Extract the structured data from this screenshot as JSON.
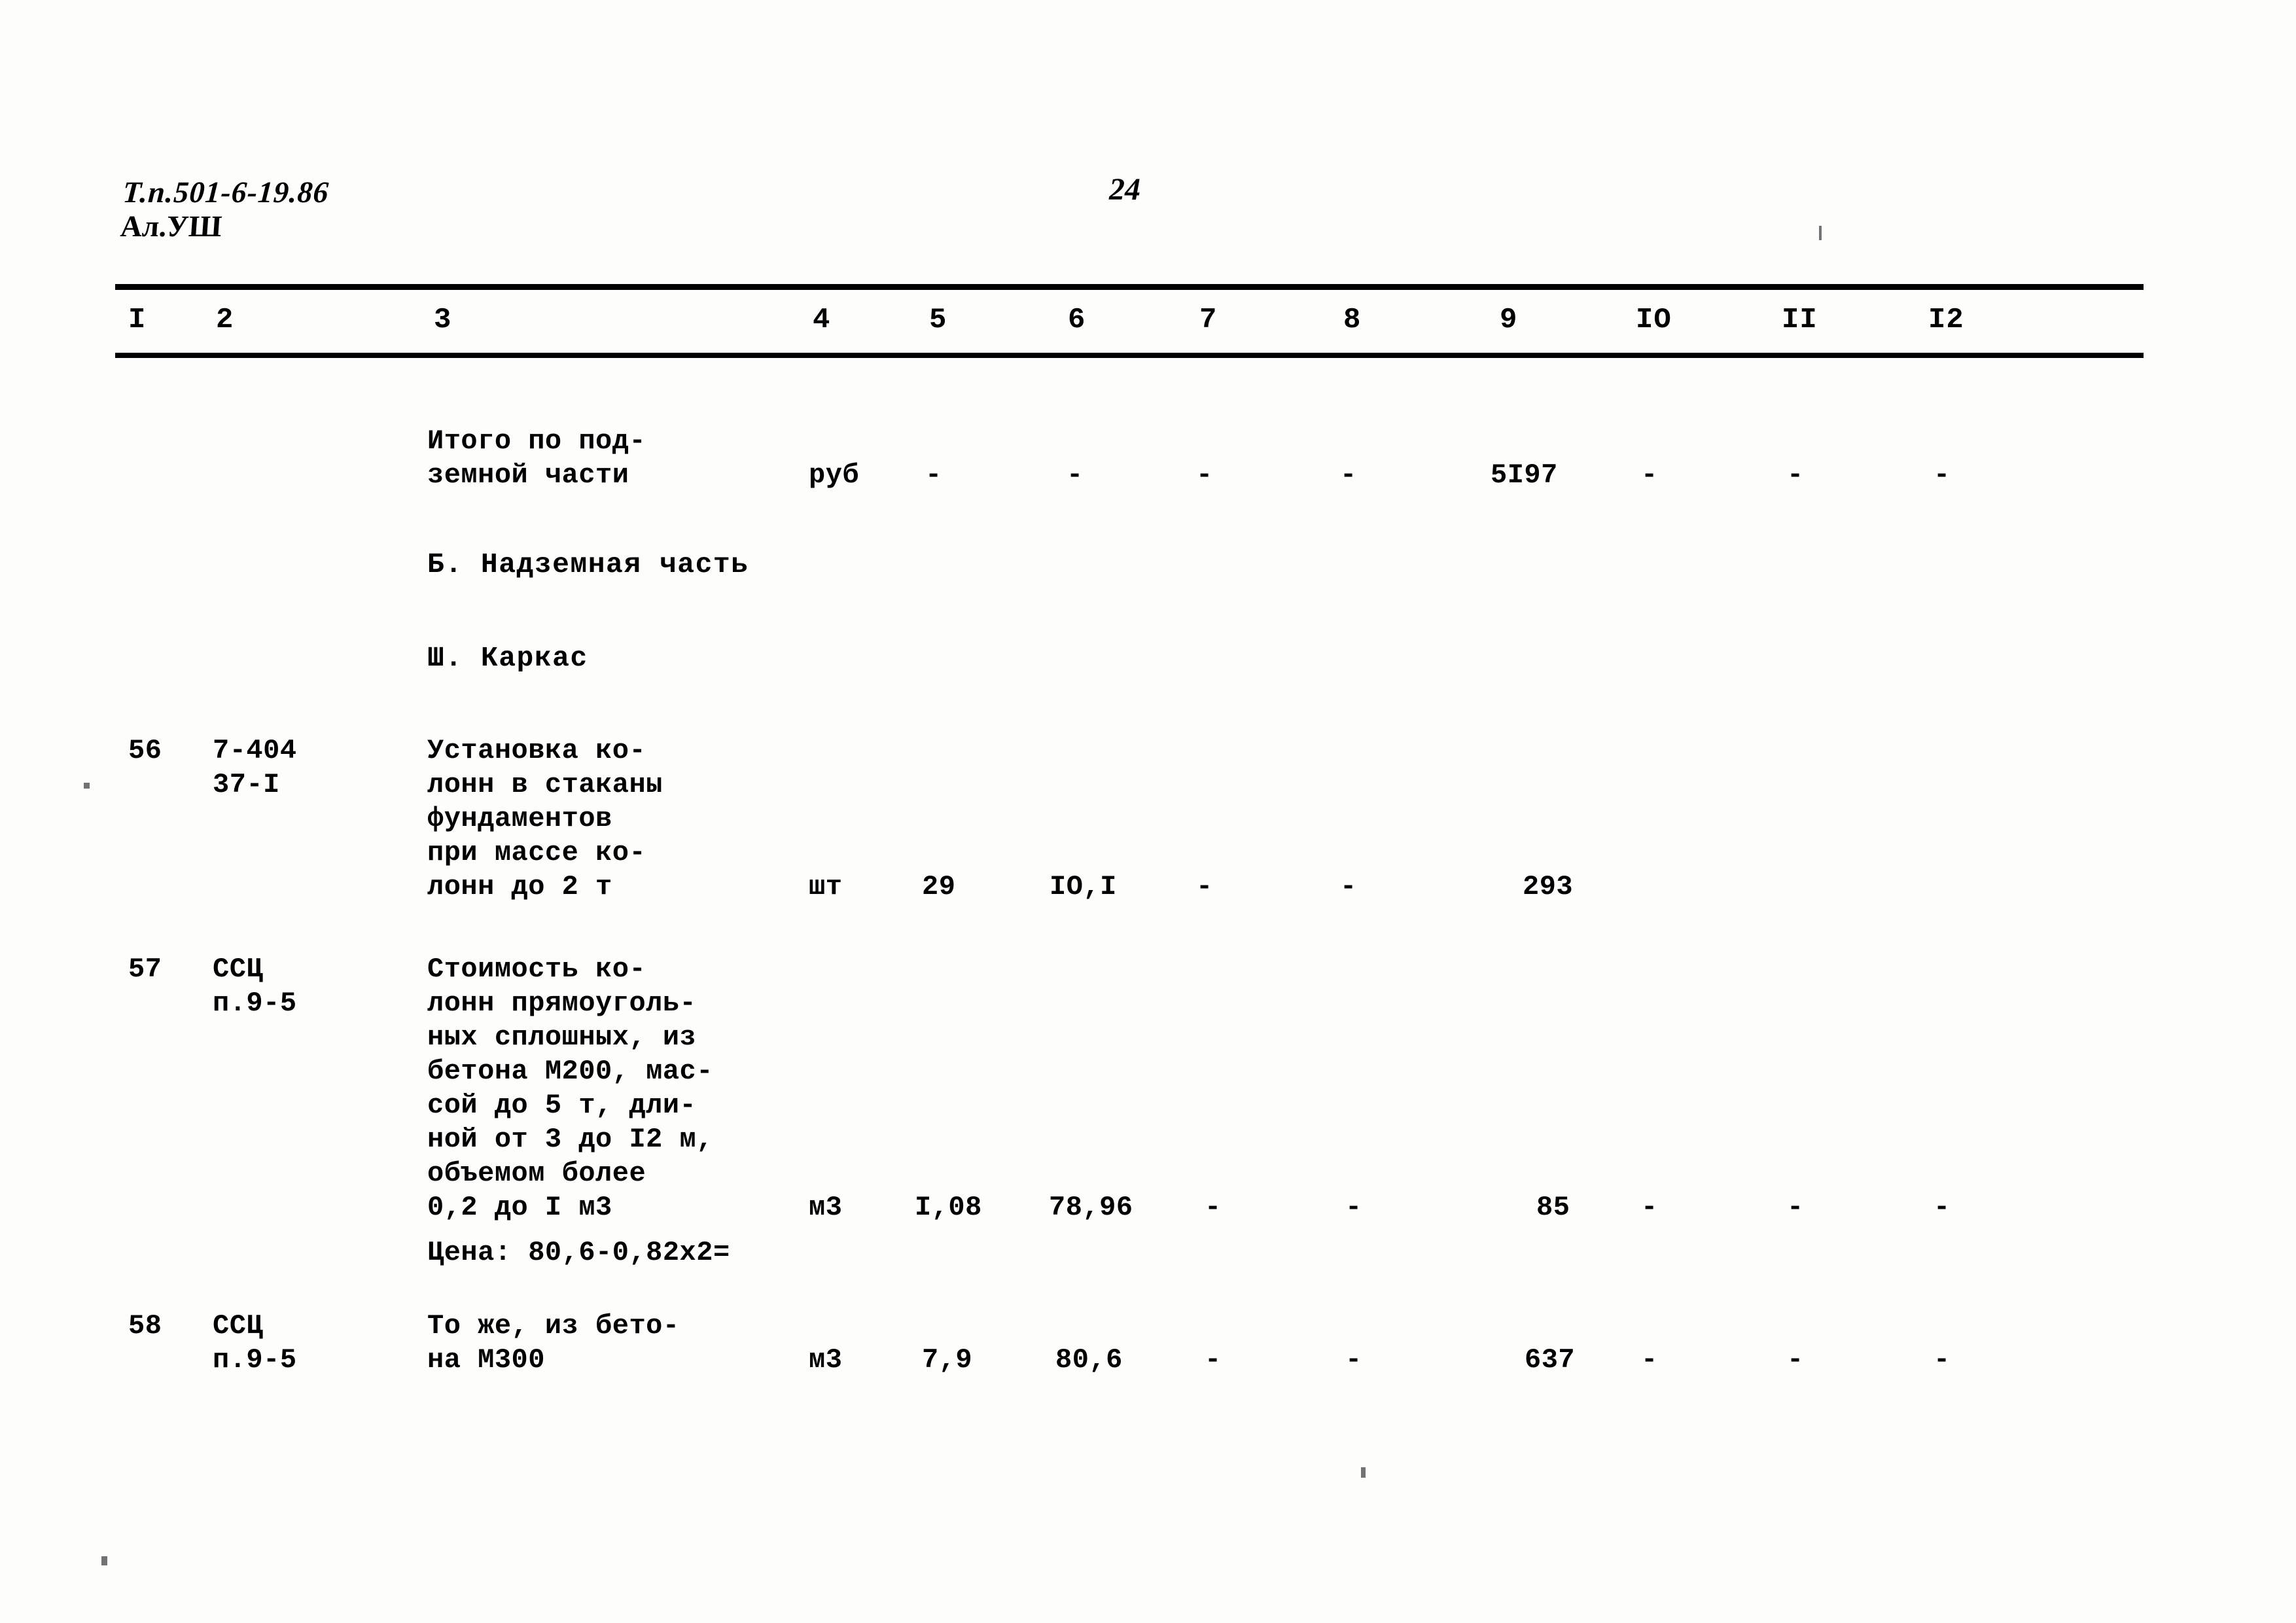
{
  "document": {
    "code_line1": "Т.п.501-6-19.86",
    "code_line2": "Ал.УШ",
    "page_number": "24"
  },
  "table": {
    "column_headers": [
      "I",
      "2",
      "3",
      "4",
      "5",
      "6",
      "7",
      "8",
      "9",
      "IO",
      "II",
      "I2"
    ],
    "rows": [
      {
        "no": "",
        "code": "",
        "description": "Итого по под-\nземной части",
        "unit": "руб",
        "c5": "-",
        "c6": "-",
        "c7": "-",
        "c8": "-",
        "c9": "5I97",
        "c10": "-",
        "c11": "-",
        "c12": "-"
      },
      {
        "no": "56",
        "code": "7-404\n37-I",
        "description": "Установка ко-\nлонн в стаканы\nфундаментов\nпри массе ко-\nлонн до 2 т",
        "unit": "шт",
        "c5": "29",
        "c6": "IO,I",
        "c7": "-",
        "c8": "-",
        "c9": "293",
        "c10": "",
        "c11": "",
        "c12": ""
      },
      {
        "no": "57",
        "code": "ССЦ\nп.9-5",
        "description": "Стоимость ко-\nлонн прямоуголь-\nных сплошных, из\nбетона М200, мас-\nсой до 5 т, дли-\nной от 3 до I2 м,\nобъемом более\n0,2 до I м3",
        "unit": "м3",
        "c5": "I,08",
        "c6": "78,96",
        "c7": "-",
        "c8": "-",
        "c9": "85",
        "c10": "-",
        "c11": "-",
        "c12": "-"
      },
      {
        "no": "58",
        "code": "ССЦ\nп.9-5",
        "description": "То же, из бето-\nна М300",
        "unit": "м3",
        "c5": "7,9",
        "c6": "80,6",
        "c7": "-",
        "c8": "-",
        "c9": "637",
        "c10": "-",
        "c11": "-",
        "c12": "-"
      }
    ],
    "section_headings": [
      "Б. Надземная часть",
      "Ш. Каркас"
    ],
    "price_note": "Цена: 80,6-0,82х2="
  }
}
